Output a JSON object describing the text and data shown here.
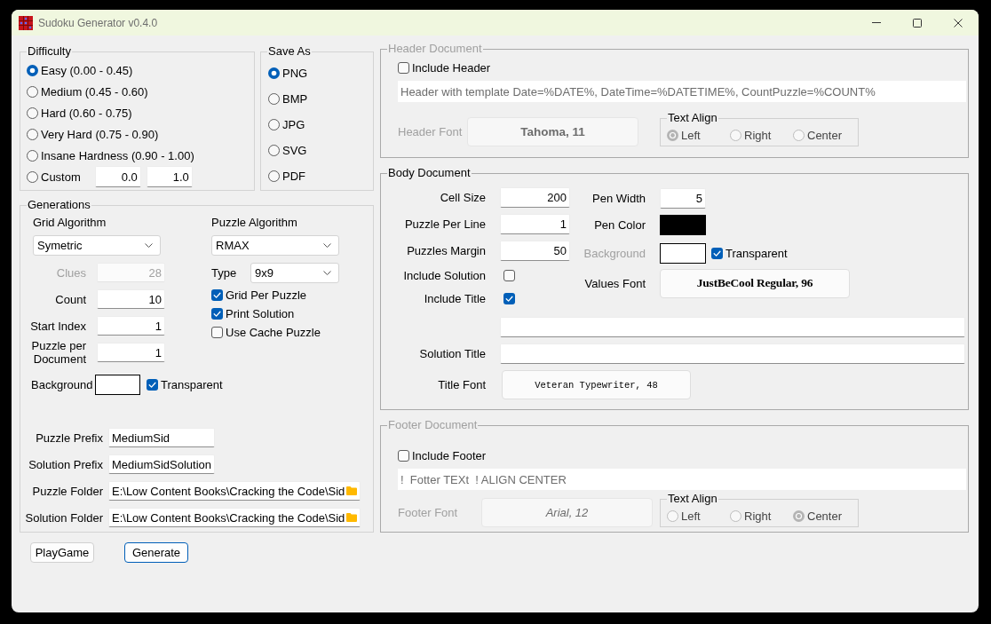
{
  "window": {
    "title": "Sudoku Generator v0.4.0"
  },
  "difficulty": {
    "title": "Difficulty",
    "options": [
      {
        "kind": "preset",
        "label": "Easy (0.00 - 0.45)",
        "selected": true
      },
      {
        "kind": "preset",
        "label": "Medium (0.45 - 0.60)",
        "selected": false
      },
      {
        "kind": "preset",
        "label": "Hard (0.60 - 0.75)",
        "selected": false
      },
      {
        "kind": "preset",
        "label": "Very Hard (0.75 - 0.90)",
        "selected": false
      },
      {
        "kind": "preset",
        "label": "Insane Hardness (0.90 - 1.00)",
        "selected": false
      },
      {
        "kind": "custom",
        "label": "Custom",
        "selected": false,
        "min": "0.0",
        "max": "1.0"
      }
    ]
  },
  "save_as": {
    "title": "Save As",
    "options": [
      {
        "label": "PNG",
        "selected": true
      },
      {
        "label": "BMP",
        "selected": false
      },
      {
        "label": "JPG",
        "selected": false
      },
      {
        "label": "SVG",
        "selected": false
      },
      {
        "label": "PDF",
        "selected": false
      }
    ]
  },
  "generations": {
    "title": "Generations",
    "grid_algorithm": {
      "label": "Grid Algorithm",
      "value": "Symetric"
    },
    "puzzle_algorithm": {
      "label": "Puzzle Algorithm",
      "value": "RMAX"
    },
    "fields": [
      {
        "label": "Clues",
        "value": "28",
        "disabled": true
      },
      {
        "label": "Count",
        "value": "10",
        "disabled": false
      },
      {
        "label": "Start Index",
        "value": "1",
        "disabled": false
      },
      {
        "label": "Puzzle per Document",
        "value": "1",
        "disabled": false
      }
    ],
    "type": {
      "label": "Type",
      "value": "9x9"
    },
    "options": [
      {
        "label": "Grid Per Puzzle",
        "checked": true
      },
      {
        "label": "Print Solution",
        "checked": true
      },
      {
        "label": "Use Cache Puzzle",
        "checked": false
      }
    ],
    "background": {
      "label": "Background",
      "color": "#ffffff",
      "transparent_label": "Transparent",
      "transparent": true
    },
    "paths": [
      {
        "kind": "text",
        "label": "Puzzle Prefix",
        "value": "MediumSid"
      },
      {
        "kind": "text",
        "label": "Solution Prefix",
        "value": "MediumSidSolution"
      },
      {
        "kind": "folder",
        "label": "Puzzle Folder",
        "value": "E:\\Low Content Books\\Cracking the Code\\Sid"
      },
      {
        "kind": "folder",
        "label": "Solution Folder",
        "value": "E:\\Low Content Books\\Cracking the Code\\Sid"
      }
    ]
  },
  "buttons": [
    {
      "label": "PlayGame",
      "default": false
    },
    {
      "label": "Generate",
      "default": true
    }
  ],
  "header": {
    "title": "Header Document",
    "disabled": true,
    "include": {
      "label": "Include Header",
      "checked": false
    },
    "template": "Header with template Date=%DATE%, DateTime=%DATETIME%, CountPuzzle=%COUNT%",
    "font_label": "Header Font",
    "font": "Tahoma, 11",
    "align": {
      "title": "Text Align",
      "options": [
        {
          "label": "Left",
          "selected": true
        },
        {
          "label": "Right",
          "selected": false
        },
        {
          "label": "Center",
          "selected": false
        }
      ]
    }
  },
  "body": {
    "title": "Body Document",
    "fields": [
      {
        "label": "Cell Size",
        "value": "200"
      },
      {
        "label": "Puzzle Per Line",
        "value": "1"
      },
      {
        "label": "Puzzles Margin",
        "value": "50"
      }
    ],
    "checks": [
      {
        "label": "Include Solution",
        "checked": false
      },
      {
        "label": "Include Title",
        "checked": true
      }
    ],
    "pen_width": {
      "label": "Pen Width",
      "value": "5"
    },
    "pen_color": {
      "label": "Pen Color",
      "color": "#000000"
    },
    "background": {
      "label": "Background",
      "disabled": true,
      "color": "#ffffff",
      "transparent_label": "Transparent",
      "transparent": true
    },
    "values_font": {
      "label": "Values Font",
      "text": "JustBeCool Regular, 96"
    },
    "title_fields": [
      {
        "kind": "blank"
      },
      {
        "kind": "labeled",
        "label": "Solution Title"
      }
    ],
    "title_font": {
      "label": "Title Font",
      "text": "Veteran Typewriter, 48"
    }
  },
  "footer": {
    "title": "Footer Document",
    "disabled": true,
    "include": {
      "label": "Include Footer",
      "checked": false
    },
    "template": "!  Fotter TEXt  ! ALIGN CENTER",
    "font_label": "Footer Font",
    "font": "Arial, 12",
    "align": {
      "title": "Text Align",
      "options": [
        {
          "label": "Left",
          "selected": false
        },
        {
          "label": "Right",
          "selected": false
        },
        {
          "label": "Center",
          "selected": true
        }
      ]
    }
  }
}
